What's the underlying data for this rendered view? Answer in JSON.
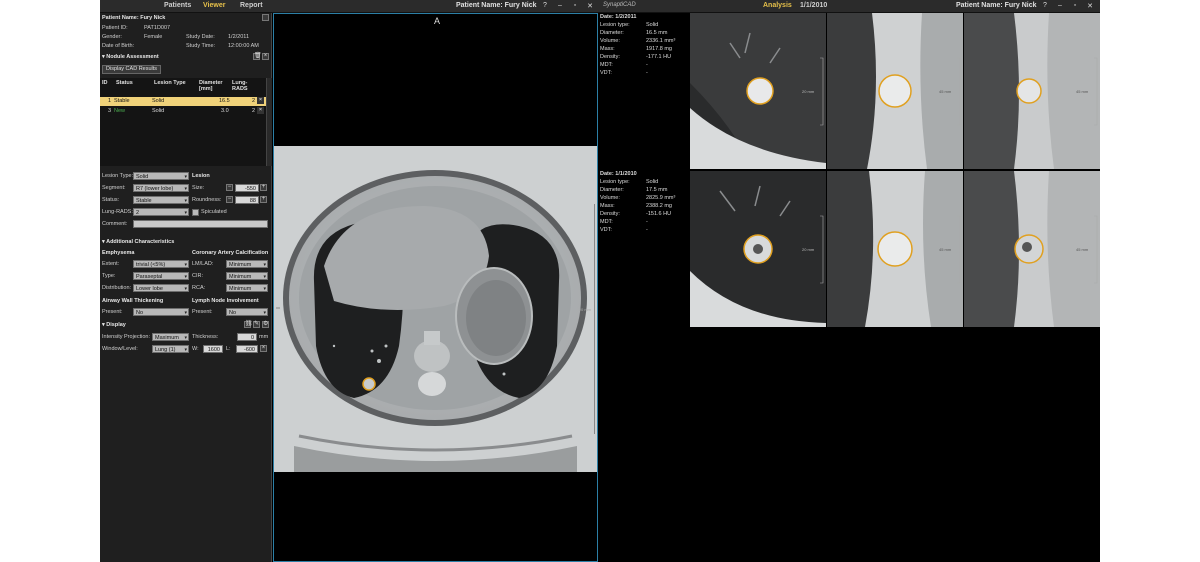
{
  "left_topbar": {
    "nav": [
      "Patients",
      "Viewer",
      "Report"
    ],
    "patient_name": "Patient Name: Fury Nick",
    "buttons": [
      "?",
      "–",
      "▫",
      "✕"
    ]
  },
  "right_topbar": {
    "logo": "SynaptiCAD",
    "tab": "Analysis",
    "date": "1/1/2010",
    "patient_name": "Patient Name: Fury Nick",
    "buttons": [
      "?",
      "–",
      "▫",
      "✕"
    ]
  },
  "patient": {
    "header": "Patient Name: Fury Nick",
    "id_label": "Patient ID:",
    "id_value": "PAT1D007",
    "gender_label": "Gender:",
    "gender_value": "Female",
    "dob_label": "Date of Birth:",
    "study_date_label": "Study Date:",
    "study_date_value": "1/2/2011",
    "study_time_label": "Study Time:",
    "study_time_value": "12:00:00 AM"
  },
  "nodule": {
    "header": "Nodule Assessment",
    "display_cad_button": "Display CAD Results",
    "columns": [
      "ID",
      "Status",
      "Lesion Type",
      "Diameter [mm]",
      "Lung-RADS"
    ],
    "rows": [
      {
        "id": "1",
        "status": "Stable",
        "type": "Solid",
        "diameter": "16.5",
        "rads": "2"
      },
      {
        "id": "3",
        "status": "New",
        "type": "Solid",
        "diameter": "3.0",
        "rads": "2"
      }
    ]
  },
  "lesion_form": {
    "lesion_type_label": "Lesion Type:",
    "lesion_type_value": "Solid",
    "lesion_label": "Lesion",
    "segment_label": "Segment:",
    "segment_value": "R7 (lower lobe)",
    "size_label": "Size:",
    "size_value": "-550",
    "status_label": "Status:",
    "status_value": "Stable",
    "roundness_label": "Roundness:",
    "roundness_value": "88",
    "lungrads_label": "Lung-RADS:",
    "lungrads_value": "2",
    "spiculated_label": "Spiculated",
    "comment_label": "Comment:"
  },
  "additional": {
    "header": "Additional Characteristics",
    "emphysema_header": "Emphysema",
    "coronary_header": "Coronary Artery Calcification",
    "extent_label": "Extent:",
    "extent_value": "trivial (<5%)",
    "lmlad_label": "LM/LAD:",
    "lmlad_value": "Minimum",
    "type_label": "Type:",
    "type_value": "Paraseptal",
    "cir_label": "CIR:",
    "cir_value": "Minimum",
    "distribution_label": "Distribution:",
    "distribution_value": "Lower lobe",
    "rca_label": "RCA:",
    "rca_value": "Minimum",
    "airway_header": "Airway Wall Thickening",
    "lymph_header": "Lymph Node Involvement",
    "present_label": "Present:",
    "present_value": "No",
    "present2_label": "Present:",
    "present2_value": "No"
  },
  "display": {
    "header": "Display",
    "ip_label": "Intensity Projection:",
    "ip_value": "Maximum",
    "thickness_label": "Thickness:",
    "thickness_value": "0",
    "thickness_unit": "mm",
    "wl_label": "Window/Level:",
    "wl_value": "Lung (1)",
    "w_label": "W:",
    "w_value": "1600",
    "l_label": "L:",
    "l_value": "-600"
  },
  "center": {
    "label": "A",
    "ruler_label": "20 mm"
  },
  "info_top": [
    "Date: 1/2/2011",
    "Lesion type:",
    "Diameter:",
    "Volume:",
    "Mass:",
    "Density:",
    "MDT:",
    "VDT:"
  ],
  "info_top_values": [
    "Solid",
    "16.5 mm",
    "2336.1 mm³",
    "1917.8 mg",
    "-177.1 HU",
    "-",
    "-"
  ],
  "info_bottom": [
    "Date: 1/1/2010",
    "Lesion type:",
    "Diameter:",
    "Volume:",
    "Mass:",
    "Density:",
    "MDT:",
    "VDT:"
  ],
  "info_bottom_values": [
    "Solid",
    "17.5 mm",
    "2825.9 mm³",
    "2388.2 mg",
    "-151.6 HU",
    "-",
    "-"
  ],
  "thumb_scale": [
    "20 mm",
    "45 mm",
    "45 mm"
  ],
  "colors": {
    "accent": "#e6c04a",
    "selected_row": "#f0d27a",
    "viewer_border": "#2c7fa6",
    "nodule_outline": "#e0a020",
    "new_status": "#4caf50"
  }
}
